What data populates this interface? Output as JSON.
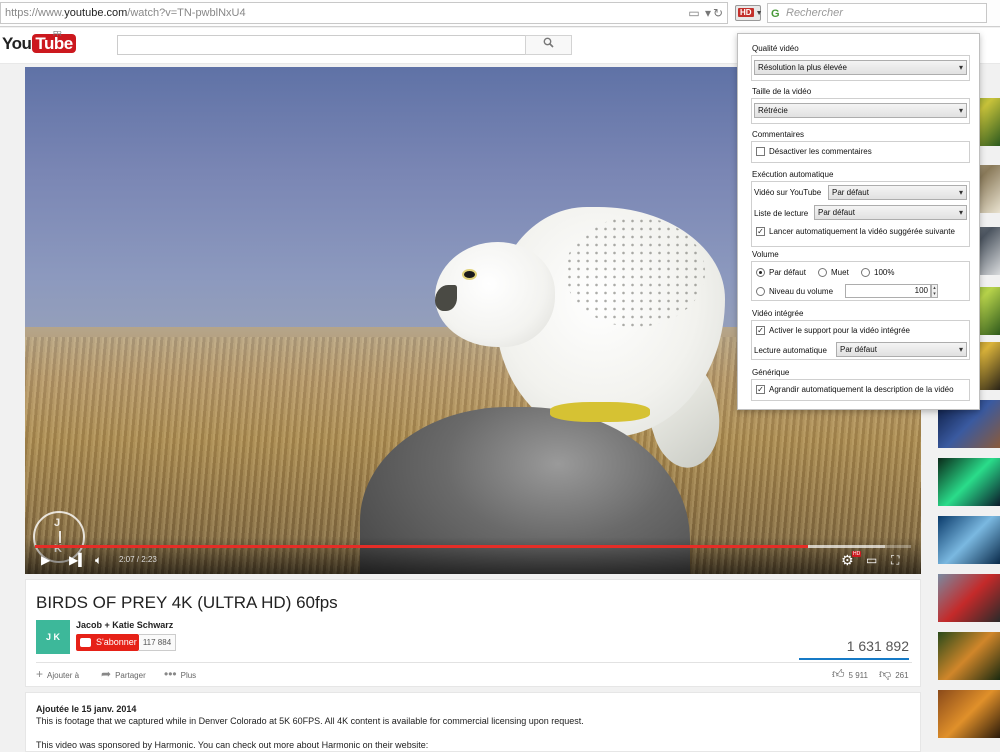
{
  "browser": {
    "url_prefix": "https://www.",
    "url_host": "youtube.com",
    "url_path": "/watch?v=TN-pwblNxU4",
    "search_placeholder": "Rechercher",
    "hd_badge": "HD"
  },
  "header": {
    "logo_you": "You",
    "logo_tube": "Tube",
    "logo_region": "FR"
  },
  "player": {
    "time": "2:07 / 2:23",
    "progress_fraction": 0.882,
    "buffered_fraction": 0.97,
    "watermark_top": "J",
    "watermark_bottom": "K",
    "hd_mark": "HD"
  },
  "video": {
    "title": "BIRDS OF PREY 4K (ULTRA HD) 60fps",
    "channel": "Jacob + Katie Schwarz",
    "subscribe_label": "S'abonner",
    "subscriber_count": "117 884",
    "views": "1 631 892",
    "actions": {
      "add_to": "Ajouter à",
      "share": "Partager",
      "more": "Plus"
    },
    "likes": "5 911",
    "dislikes": "261",
    "avatar_text": "J K"
  },
  "description": {
    "date": "Ajoutée le 15 janv. 2014",
    "line1": "This is footage that we captured while in Denver Colorado at 5K 60FPS. All 4K content is available for commercial licensing upon request.",
    "line2": "This video was sponsored by Harmonic. You can check out more about Harmonic on their website:"
  },
  "panel": {
    "quality_label": "Qualité vidéo",
    "quality_value": "Résolution la plus élevée",
    "size_label": "Taille de la vidéo",
    "size_value": "Rétrécie",
    "comments_label": "Commentaires",
    "comments_disable": "Désactiver les commentaires",
    "autoplay_label": "Exécution automatique",
    "autoplay_video_label": "Vidéo sur YouTube",
    "autoplay_video_value": "Par défaut",
    "autoplay_playlist_label": "Liste de lecture",
    "autoplay_playlist_value": "Par défaut",
    "autoplay_suggested": "Lancer automatiquement la vidéo suggérée suivante",
    "volume_label": "Volume",
    "volume_default": "Par défaut",
    "volume_mute": "Muet",
    "volume_100": "100%",
    "volume_level_label": "Niveau du volume",
    "volume_level_value": "100",
    "embed_label": "Vidéo intégrée",
    "embed_support": "Activer le support pour la vidéo intégrée",
    "embed_autoplay_label": "Lecture automatique",
    "embed_autoplay_value": "Par défaut",
    "credits_label": "Générique",
    "credits_expand": "Agrandir automatiquement la description de la vidéo"
  },
  "colors": {
    "accent_red": "#cc181e",
    "progress_red": "#e52d27",
    "view_bar_blue": "#167ac6"
  }
}
